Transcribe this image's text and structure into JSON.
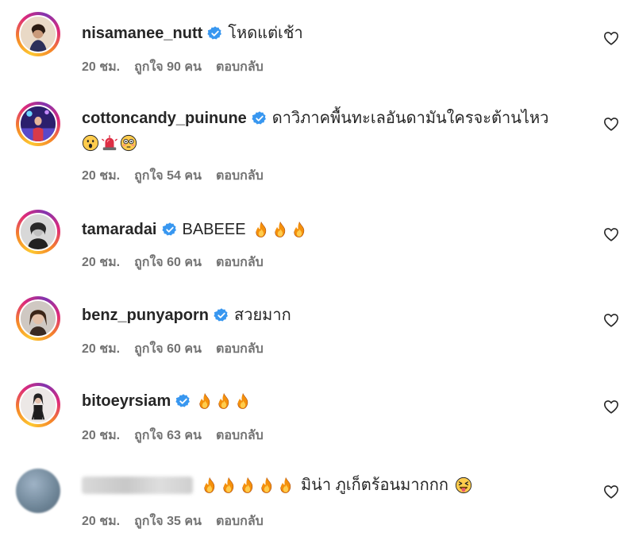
{
  "colors": {
    "verified": "#3897f0",
    "meta": "#737373",
    "username": "#262626"
  },
  "comments": [
    {
      "username": "nisamanee_nutt",
      "text": "โหดแต่เช้า",
      "time": "20 ชม.",
      "likes": "ถูกใจ 90 คน",
      "reply": "ตอบกลับ"
    },
    {
      "username": "cottoncandy_puinune",
      "text": "ดาวิภาคพื้นทะเลอันดามันใครจะต้านไหว",
      "emojis": [
        "face-open-mouth",
        "police-light",
        "flushed-face"
      ],
      "time": "20 ชม.",
      "likes": "ถูกใจ 54 คน",
      "reply": "ตอบกลับ"
    },
    {
      "username": "tamaradai",
      "text": "BABEEE",
      "emojis": [
        "fire",
        "fire",
        "fire"
      ],
      "time": "20 ชม.",
      "likes": "ถูกใจ 60 คน",
      "reply": "ตอบกลับ"
    },
    {
      "username": "benz_punyaporn",
      "text": "สวยมาก",
      "time": "20 ชม.",
      "likes": "ถูกใจ 60 คน",
      "reply": "ตอบกลับ"
    },
    {
      "username": "bitoeyrsiam",
      "text": "",
      "emojis": [
        "fire",
        "fire",
        "fire"
      ],
      "time": "20 ชม.",
      "likes": "ถูกใจ 63 คน",
      "reply": "ตอบกลับ"
    },
    {
      "username": "",
      "text": "มิน่า ภูเก็ตร้อนมากกก",
      "emojis": [
        "fire",
        "fire",
        "fire",
        "fire",
        "fire"
      ],
      "trailing_emoji": "squinting-tongue-face",
      "time": "20 ชม.",
      "likes": "ถูกใจ 35 คน",
      "reply": "ตอบกลับ"
    }
  ]
}
